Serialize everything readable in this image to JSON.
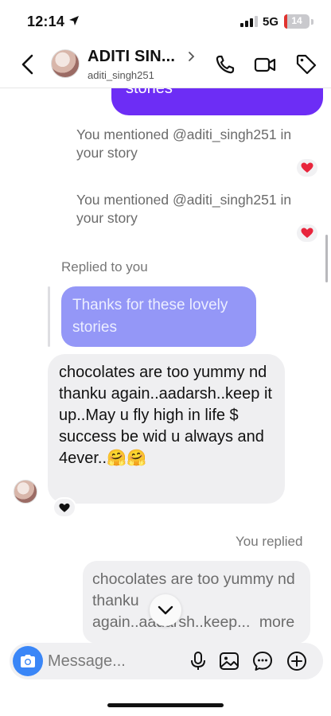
{
  "status_bar": {
    "time": "12:14",
    "network": "5G",
    "battery_level": "14",
    "battery_fill": 0.14,
    "location_icon": "location-arrow-icon",
    "signal_icon": "signal-bars-icon"
  },
  "header": {
    "contact_name": "ADITI SIN...",
    "username": "aditi_singh251",
    "icons": [
      "back-chevron-icon",
      "chevron-right-icon",
      "phone-icon",
      "video-camera-icon",
      "tag-icon"
    ]
  },
  "messages": {
    "sent_top_text": "stories",
    "mention_1": "You mentioned @aditi_singh251 in your story",
    "mention_2": "You mentioned @aditi_singh251 in your story",
    "replied_label": "Replied to you",
    "quoted_reply": "Thanks for these lovely stories",
    "received_text": "chocolates are too yummy nd thanku again..aadarsh..keep it up..May u fly high in life $ success be wid u always and 4ever..🤗🤗",
    "you_replied_label": "You replied",
    "reply_preview_text": "chocolates are too yummy nd thanku again..aadarsh..keep...",
    "more_label": "more"
  },
  "composer": {
    "placeholder": "Message..."
  },
  "colors": {
    "sent_bubble": "#6d2df5",
    "quoted_bubble": "#9497f7",
    "received_bubble": "#efeff1",
    "camera_button": "#3a86f7",
    "heart_red": "#e8253c"
  }
}
